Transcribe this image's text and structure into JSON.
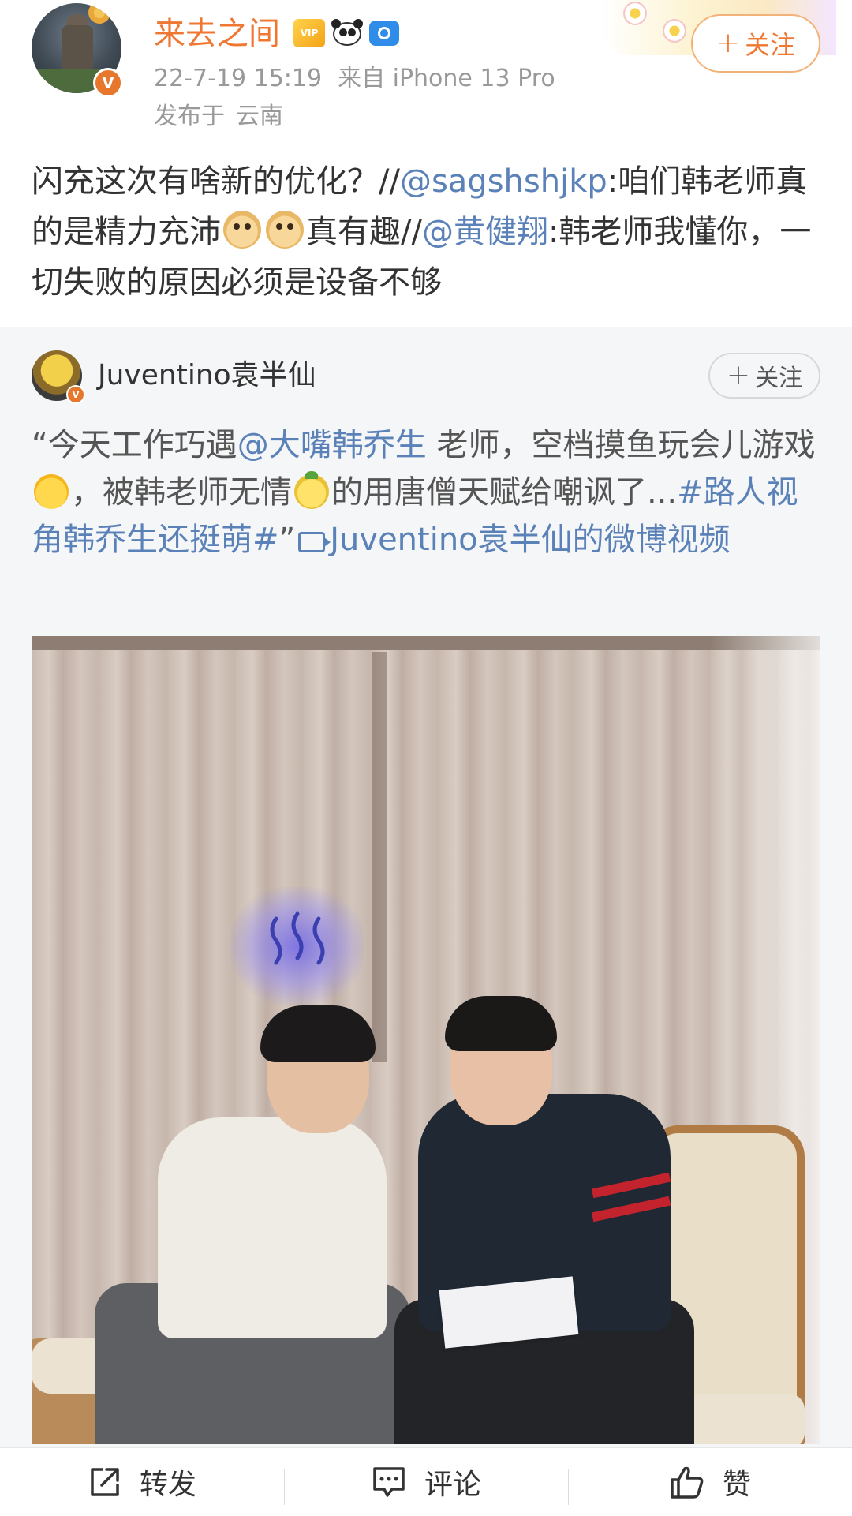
{
  "post": {
    "username": "来去之间",
    "timestamp": "22-7-19 15:19",
    "source": "来自 iPhone 13 Pro",
    "location_prefix": "发布于",
    "location": "云南",
    "follow_label": "关注",
    "badges": [
      "vip-badge",
      "panda-badge",
      "camera-badge"
    ],
    "text": {
      "part1": "闪充这次有啥新的优化？//",
      "mention1": "@sagshshjkp",
      "part2": ":咱们韩老师真的是精力充沛",
      "part3": "真有趣//",
      "mention2": "@黄健翔",
      "part4": ":韩老师我懂你，一切失败的原因必须是设备不够"
    }
  },
  "repost": {
    "username": "Juventino袁半仙",
    "follow_label": "关注",
    "text": {
      "part1": "“今天工作巧遇",
      "mention": "@大嘴韩乔生",
      "part2": " 老师，空档摸鱼玩会儿游戏",
      "part3": "，被韩老师无情",
      "part4": "的用唐僧天赋给嘲讽了...",
      "hashtag": "#路人视角韩乔生还挺萌#",
      "part5": "”",
      "video_link": "Juventino袁半仙的微博视频"
    }
  },
  "actions": {
    "repost": "转发",
    "comment": "评论",
    "like": "赞"
  },
  "colors": {
    "username_orange": "#f07732",
    "link_blue": "#5b82b8",
    "meta_gray": "#999999",
    "repost_bg": "#f5f6f7"
  }
}
